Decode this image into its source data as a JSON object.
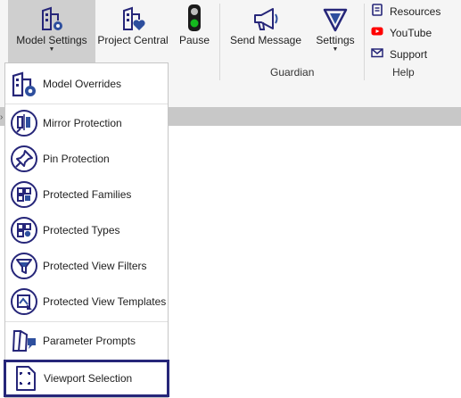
{
  "ribbon": {
    "model_settings": {
      "label": "Model Settings",
      "icon": "building-gear-icon"
    },
    "project_central": {
      "label": "Project Central",
      "icon": "building-heart-icon"
    },
    "pause": {
      "label": "Pause",
      "icon": "traffic-light-icon"
    },
    "send_message": {
      "label": "Send Message",
      "icon": "megaphone-icon"
    },
    "settings": {
      "label": "Settings",
      "icon": "guardian-logo-icon"
    },
    "guardian_group_label": "Guardian",
    "help": {
      "resources": "Resources",
      "youtube": "YouTube",
      "support": "Support",
      "group_label": "Help"
    }
  },
  "menu": {
    "items": [
      {
        "label": "Model Overrides",
        "icon": "building-gear-icon"
      },
      {
        "label": "Mirror Protection",
        "icon": "mirror-icon"
      },
      {
        "label": "Pin Protection",
        "icon": "pin-icon"
      },
      {
        "label": "Protected Families",
        "icon": "families-icon"
      },
      {
        "label": "Protected Types",
        "icon": "types-icon"
      },
      {
        "label": "Protected View Filters",
        "icon": "filter-icon"
      },
      {
        "label": "Protected View Templates",
        "icon": "view-template-icon"
      },
      {
        "label": "Parameter Prompts",
        "icon": "parameter-prompt-icon"
      },
      {
        "label": "Viewport Selection",
        "icon": "viewport-selection-icon"
      }
    ]
  },
  "colors": {
    "icon_navy": "#262679",
    "icon_blue": "#2e4f9e",
    "ribbon_bg": "#f5f5f5",
    "active_bg": "#cfcfcf",
    "selected_border": "#262679"
  }
}
